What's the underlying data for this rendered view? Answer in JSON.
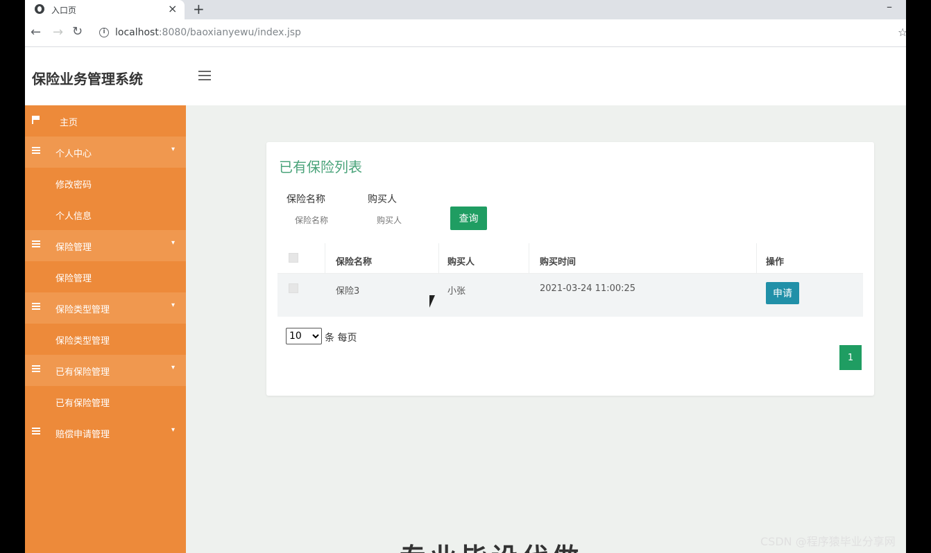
{
  "browser": {
    "tab_title": "入口页",
    "tab_close": "×",
    "new_tab": "+",
    "minimize": "–",
    "url_host": "localhost",
    "url_rest": ":8080/baoxianyewu/index.jsp"
  },
  "header": {
    "app_title": "保险业务管理系统"
  },
  "sidebar": {
    "items": [
      {
        "label": "主页",
        "type": "home"
      },
      {
        "label": "个人中心",
        "type": "parent"
      },
      {
        "label": "修改密码",
        "type": "child"
      },
      {
        "label": "个人信息",
        "type": "child"
      },
      {
        "label": "保险管理",
        "type": "parent"
      },
      {
        "label": "保险管理",
        "type": "child"
      },
      {
        "label": "保险类型管理",
        "type": "parent"
      },
      {
        "label": "保险类型管理",
        "type": "child"
      },
      {
        "label": "已有保险管理",
        "type": "parent"
      },
      {
        "label": "已有保险管理",
        "type": "child"
      },
      {
        "label": "赔偿申请管理",
        "type": "parent"
      }
    ]
  },
  "main": {
    "card_title": "已有保险列表",
    "filters": {
      "name_label": "保险名称",
      "name_placeholder": "保险名称",
      "buyer_label": "购买人",
      "buyer_placeholder": "购买人",
      "search_button": "查询"
    },
    "table": {
      "headers": [
        "保险名称",
        "购买人",
        "购买时间",
        "操作"
      ],
      "rows": [
        {
          "name": "保险3",
          "buyer": "小张",
          "time": "2021-03-24 11:00:25",
          "action": "申请"
        }
      ]
    },
    "pagination": {
      "page_size": "10",
      "page_size_options": [
        "10"
      ],
      "page_size_label": "条 每页",
      "current_page": "1"
    },
    "bottom_text": "专业毕设代做"
  },
  "watermark": "CSDN @程序猿毕业分享网",
  "colors": {
    "sidebar": "#ed8a3a",
    "accent_green": "#1f9d62",
    "apply_button": "#2190a8",
    "title_green": "#4aa37a"
  }
}
